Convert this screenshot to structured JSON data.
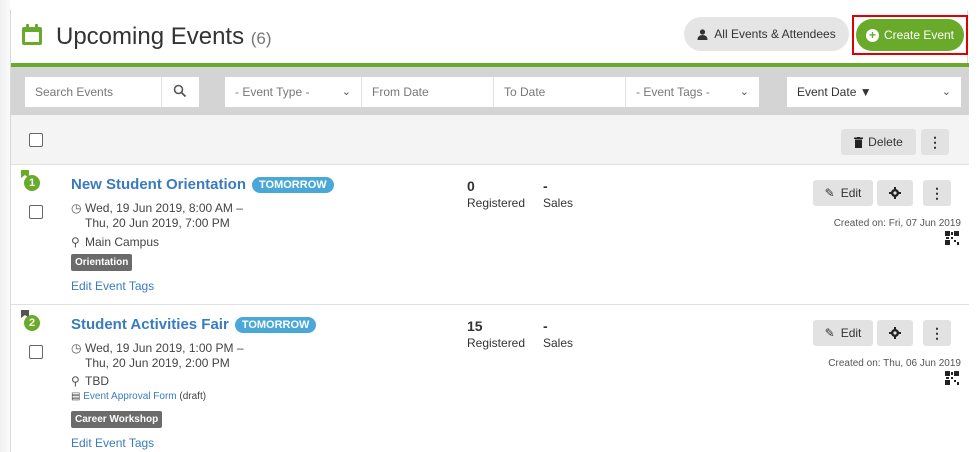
{
  "header": {
    "title": "Upcoming Events",
    "count": "(6)",
    "attendees_button": "All Events & Attendees",
    "create_button": "Create Event"
  },
  "filters": {
    "search_placeholder": "Search Events",
    "event_type": "- Event Type -",
    "from_date": "From Date",
    "to_date": "To Date",
    "event_tags": "- Event Tags -",
    "sort": "Event Date ▼"
  },
  "bulk": {
    "delete_label": "Delete"
  },
  "events": [
    {
      "number": "1",
      "title": "New Student Orientation",
      "badge": "TOMORROW",
      "date_line1": "Wed, 19 Jun 2019, 8:00 AM –",
      "date_line2": "Thu, 20 Jun 2019, 7:00 PM",
      "location": "Main Campus",
      "tag": "Orientation",
      "edit_tags": "Edit Event Tags",
      "registered_count": "0",
      "registered_label": "Registered",
      "sales_value": "-",
      "sales_label": "Sales",
      "edit_label": "Edit",
      "created": "Created on: Fri, 07 Jun 2019"
    },
    {
      "number": "2",
      "title": "Student Activities Fair",
      "badge": "TOMORROW",
      "date_line1": "Wed, 19 Jun 2019, 1:00 PM –",
      "date_line2": "Thu, 20 Jun 2019, 2:00 PM",
      "location": "TBD",
      "approval_link": "Event Approval Form",
      "approval_status": "(draft)",
      "tag": "Career Workshop",
      "edit_tags": "Edit Event Tags",
      "registered_count": "15",
      "registered_label": "Registered",
      "sales_value": "-",
      "sales_label": "Sales",
      "edit_label": "Edit",
      "created": "Created on: Thu, 06 Jun 2019"
    }
  ],
  "colors": {
    "brand_green": "#6aaa2a",
    "link_blue": "#3a7bbf",
    "badge_blue": "#4aa8d8",
    "highlight_red": "#e00000"
  }
}
